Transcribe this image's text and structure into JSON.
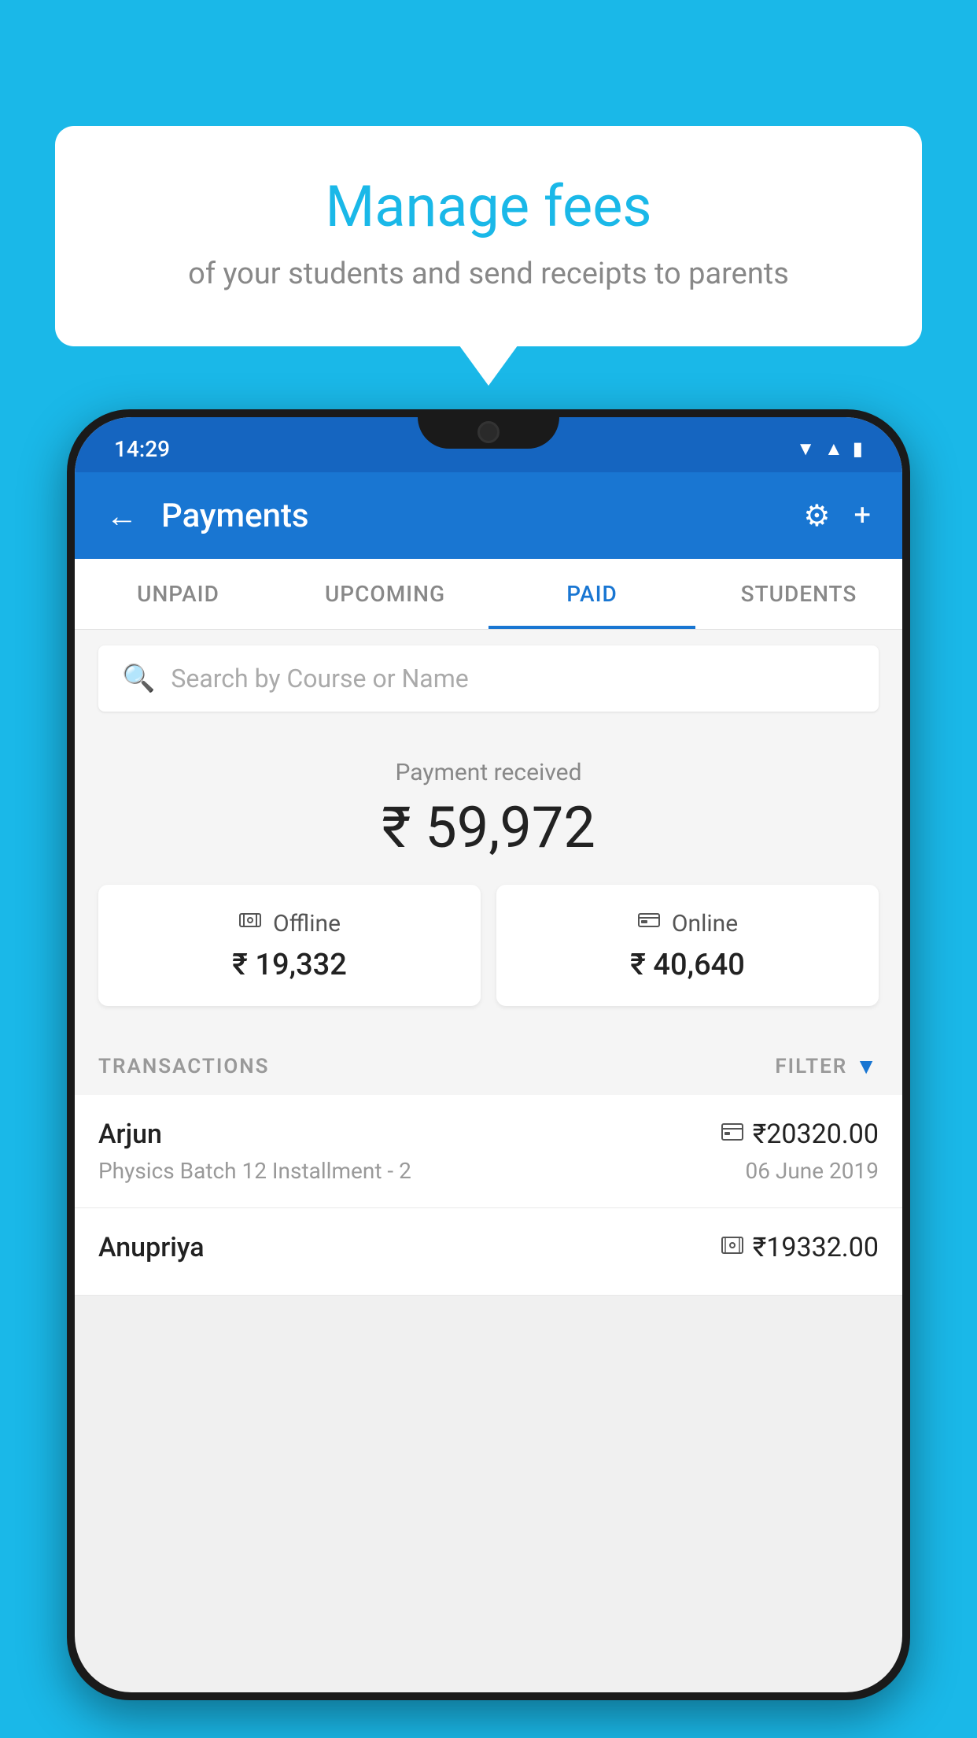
{
  "page": {
    "background_color": "#1ab8e8"
  },
  "bubble": {
    "title": "Manage fees",
    "subtitle": "of your students and send receipts to parents"
  },
  "status_bar": {
    "time": "14:29",
    "wifi_icon": "▼",
    "signal_icon": "▲",
    "battery_icon": "▮"
  },
  "app_bar": {
    "back_icon": "←",
    "title": "Payments",
    "settings_icon": "⚙",
    "add_icon": "+"
  },
  "tabs": [
    {
      "label": "UNPAID",
      "active": false
    },
    {
      "label": "UPCOMING",
      "active": false
    },
    {
      "label": "PAID",
      "active": true
    },
    {
      "label": "STUDENTS",
      "active": false
    }
  ],
  "search": {
    "placeholder": "Search by Course or Name",
    "search_icon": "🔍"
  },
  "payment_summary": {
    "label": "Payment received",
    "amount": "₹ 59,972",
    "offline": {
      "label": "Offline",
      "amount": "₹ 19,332",
      "icon": "💳"
    },
    "online": {
      "label": "Online",
      "amount": "₹ 40,640",
      "icon": "💳"
    }
  },
  "transactions": {
    "header_label": "TRANSACTIONS",
    "filter_label": "FILTER",
    "items": [
      {
        "name": "Arjun",
        "course": "Physics Batch 12 Installment - 2",
        "amount": "₹20320.00",
        "date": "06 June 2019",
        "type": "online"
      },
      {
        "name": "Anupriya",
        "course": "",
        "amount": "₹19332.00",
        "date": "",
        "type": "offline"
      }
    ]
  }
}
